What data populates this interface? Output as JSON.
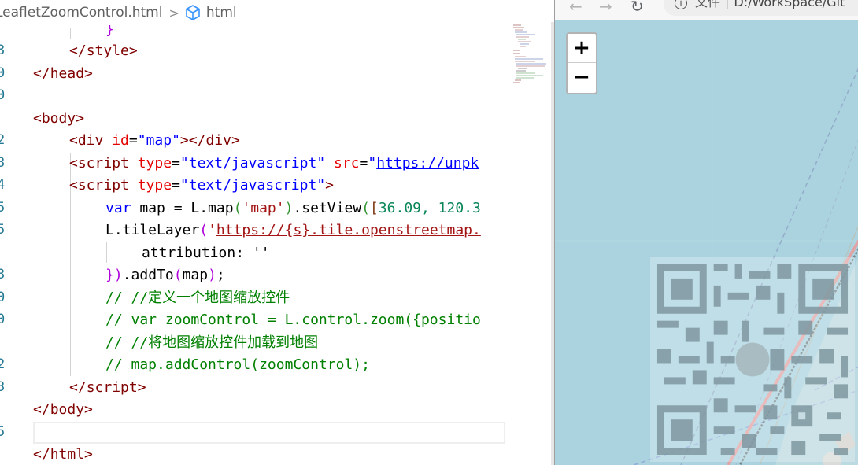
{
  "breadcrumb": {
    "file": "LeafletZoomControl.html",
    "separator": ">",
    "node": "html"
  },
  "line_numbers": [
    "",
    "3",
    "0",
    "0",
    "",
    "2",
    "3",
    "4",
    "5",
    "5",
    "",
    "3",
    "0",
    "0",
    "",
    "2",
    "3",
    "",
    "5",
    ""
  ],
  "code": {
    "l1": "}",
    "l2_open": "</",
    "l2_tag": "style",
    "l2_close": ">",
    "l3_open": "</",
    "l3_tag": "head",
    "l3_close": ">",
    "l5_open": "<",
    "l5_tag": "body",
    "l5_close": ">",
    "l6_open": "<",
    "l6_tag": "div",
    "l6_attr": "id",
    "l6_eq": "=",
    "l6_val": "\"map\"",
    "l6_end": "></",
    "l6_tag2": "div",
    "l6_close": ">",
    "l7_open": "<",
    "l7_tag": "script",
    "l7_attr": "type",
    "l7_eq": "=",
    "l7_val": "\"text/javascript\"",
    "l7_attr2": "src",
    "l7_eq2": "=",
    "l7_q": "\"",
    "l7_url": "https://unpk",
    "l8_open": "<",
    "l8_tag": "script",
    "l8_attr": "type",
    "l8_eq": "=",
    "l8_val": "\"text/javascript\"",
    "l8_close": ">",
    "l9_kw": "var",
    "l9_a": " map = L.map",
    "l9_p1": "(",
    "l9_s": "'map'",
    "l9_p2": ")",
    "l9_b": ".setView",
    "l9_p3": "(",
    "l9_br": "[",
    "l9_n": "36.09, 120.3",
    "l10_a": "L.tileLayer",
    "l10_p": "(",
    "l10_q": "'",
    "l10_url": "https://{s}.tile.openstreetmap.",
    "l11": "attribution: ''",
    "l12_a": "}",
    "l12_b": ")",
    "l12_c": ".addTo",
    "l12_d": "(",
    "l12_e": "map",
    "l12_f": ")",
    "l12_g": ";",
    "l13": "// //定义一个地图缩放控件",
    "l14": "// var zoomControl = L.control.zoom({positio",
    "l15": "// //将地图缩放控件加载到地图",
    "l16": "// map.addControl(zoomControl);",
    "l17_open": "</",
    "l17_tag": "script",
    "l17_close": ">",
    "l18_open": "</",
    "l18_tag": "body",
    "l18_close": ">",
    "l20_open": "</",
    "l20_tag": "html",
    "l20_close": ">"
  },
  "browser": {
    "back": "←",
    "forward": "→",
    "reload": "↻",
    "address_info": "i",
    "address_label": "文件",
    "address_bar": "|",
    "address_path": "D:/WorkSpace/Git"
  },
  "map": {
    "zoom_in": "+",
    "zoom_out": "−"
  },
  "colors": {
    "water": "#aad3df",
    "tag": "#800000",
    "attr": "#e50000",
    "string": "#0000ff",
    "comment": "#008000"
  }
}
